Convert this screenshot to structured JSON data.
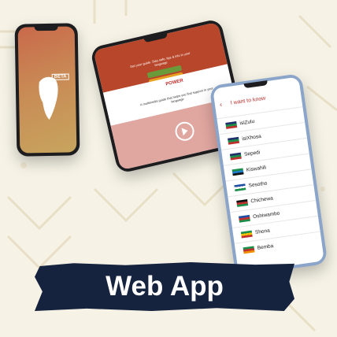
{
  "banner": {
    "label": "Web App"
  },
  "phone1": {
    "badge": "BETA"
  },
  "phone2": {
    "headline": "Get your guide. Stay safe, tips & info in your language",
    "button_primary": "",
    "button_secondary": "",
    "brand": "POWER",
    "note": "A multimedia guide that helps you find support in your language"
  },
  "phone3": {
    "title": "I want to know",
    "languages": [
      {
        "label": "isiZulu",
        "flag": [
          "#1f2f6b",
          "#1c8f4a",
          "#c0302e"
        ]
      },
      {
        "label": "isiXhosa",
        "flag": [
          "#1f2f6b",
          "#1c8f4a",
          "#c0302e"
        ]
      },
      {
        "label": "Sepedi",
        "flag": [
          "#1f2f6b",
          "#1c8f4a",
          "#c0302e"
        ]
      },
      {
        "label": "Kiswahili",
        "flag": [
          "#1c8f4a",
          "#1f7fce",
          "#111"
        ]
      },
      {
        "label": "Sesotho",
        "flag": [
          "#1f4fa3",
          "#fff",
          "#1c8f4a"
        ]
      },
      {
        "label": "Chichewa",
        "flag": [
          "#111",
          "#c0302e",
          "#1c8f4a"
        ]
      },
      {
        "label": "Oshiwambo",
        "flag": [
          "#1f4fa3",
          "#c0302e",
          "#1c8f4a"
        ]
      },
      {
        "label": "Shona",
        "flag": [
          "#1c8f4a",
          "#f2c200",
          "#c0302e"
        ]
      },
      {
        "label": "Bemba",
        "flag": [
          "#1c8f4a",
          "#c0302e",
          "#f28f00"
        ]
      }
    ]
  },
  "colors": {
    "background": "#f6f3e6",
    "banner": "#16233f",
    "accent_red": "#c0302e"
  }
}
